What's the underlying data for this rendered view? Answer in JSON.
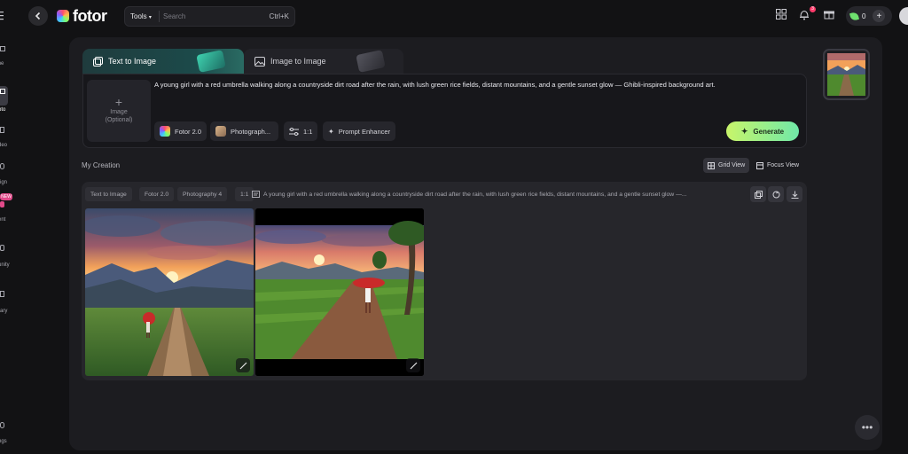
{
  "app": {
    "name": "fotor"
  },
  "header": {
    "tools_label": "Tools",
    "search_placeholder": "Search",
    "search_shortcut": "Ctrl+K",
    "notification_count": "3",
    "credits": "0"
  },
  "rail": {
    "items": [
      {
        "label": "me",
        "icon": "home-icon"
      },
      {
        "label": "oto",
        "icon": "photo-icon"
      },
      {
        "label": "deo",
        "icon": "video-icon"
      },
      {
        "label": "sign",
        "icon": "design-icon"
      },
      {
        "label": "ent",
        "icon": "content-icon"
      },
      {
        "label": "unity",
        "icon": "community-icon"
      },
      {
        "label": "rary",
        "icon": "library-icon"
      },
      {
        "label": "ngs",
        "icon": "settings-icon"
      }
    ],
    "new_badge": "NEW"
  },
  "tabs": [
    {
      "label": "Text to Image",
      "active": true
    },
    {
      "label": "Image to Image",
      "active": false
    }
  ],
  "prompt": {
    "upload_label": "Image",
    "upload_sub": "(Optional)",
    "text": "A young girl with a red umbrella walking along a countryside dirt road after the rain, with lush green rice fields, distant mountains, and a gentle sunset glow — Ghibli-inspired background art.",
    "chips": {
      "model": "Fotor 2.0",
      "style": "Photograph...",
      "ratio": "1:1",
      "enhancer": "Prompt Enhancer"
    },
    "generate_label": "Generate"
  },
  "creation": {
    "title": "My Creation",
    "grid_view": "Grid View",
    "focus_view": "Focus View",
    "meta": {
      "mode": "Text to Image",
      "model": "Fotor 2.0",
      "style": "Photography 4",
      "ratio": "1:1",
      "prompt": "A young girl with a red umbrella walking along a countryside dirt road after the rain, with lush green rice fields, distant mountains, and a gentle sunset glow —..."
    }
  },
  "colors": {
    "accent_start": "#c8f56a",
    "accent_end": "#6fe8a8",
    "notification": "#ff3b6b",
    "new_badge": "#e24a8a"
  }
}
